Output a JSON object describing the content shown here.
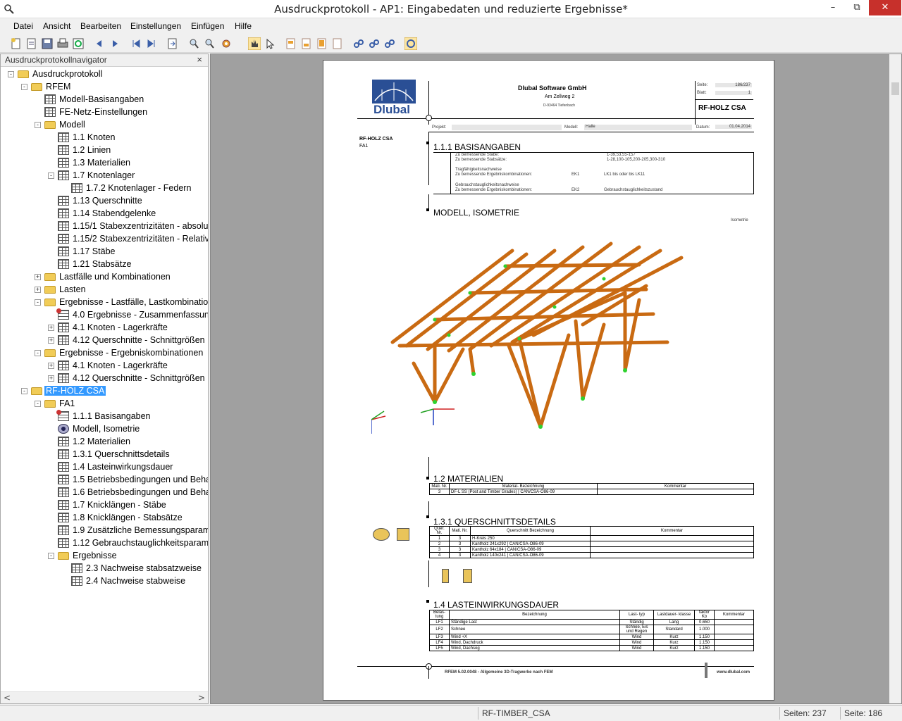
{
  "window": {
    "title": "Ausdruckprotokoll - AP1: Eingabedaten und reduzierte Ergebnisse*",
    "minimize": "–",
    "maximize": "⧉",
    "close": "✕"
  },
  "menu": [
    "Datei",
    "Ansicht",
    "Bearbeiten",
    "Einstellungen",
    "Einfügen",
    "Hilfe"
  ],
  "navigator": {
    "title": "Ausdruckprotokollnavigator",
    "close": "×",
    "scroll_left": "<",
    "scroll_right": ">",
    "items": [
      {
        "label": "Ausdruckprotokoll",
        "icon": "folder-icon",
        "level": 0,
        "exp": "-"
      },
      {
        "label": "RFEM",
        "icon": "folder-icon",
        "level": 1,
        "exp": "-"
      },
      {
        "label": "Modell-Basisangaben",
        "icon": "table-icon",
        "level": 2,
        "exp": ""
      },
      {
        "label": "FE-Netz-Einstellungen",
        "icon": "table-icon",
        "level": 2,
        "exp": ""
      },
      {
        "label": "Modell",
        "icon": "folder-icon",
        "level": 2,
        "exp": "-"
      },
      {
        "label": "1.1 Knoten",
        "icon": "table-icon",
        "level": 3,
        "exp": ""
      },
      {
        "label": "1.2 Linien",
        "icon": "table-icon",
        "level": 3,
        "exp": ""
      },
      {
        "label": "1.3 Materialien",
        "icon": "table-icon",
        "level": 3,
        "exp": ""
      },
      {
        "label": "1.7 Knotenlager",
        "icon": "table-icon",
        "level": 3,
        "exp": "-"
      },
      {
        "label": "1.7.2 Knotenlager - Federn",
        "icon": "table-icon",
        "level": 4,
        "exp": ""
      },
      {
        "label": "1.13 Querschnitte",
        "icon": "table-icon",
        "level": 3,
        "exp": ""
      },
      {
        "label": "1.14 Stabendgelenke",
        "icon": "table-icon",
        "level": 3,
        "exp": ""
      },
      {
        "label": "1.15/1 Stabexzentrizitäten - absolut",
        "icon": "table-icon",
        "level": 3,
        "exp": ""
      },
      {
        "label": "1.15/2 Stabexzentrizitäten - Relativ",
        "icon": "table-icon",
        "level": 3,
        "exp": ""
      },
      {
        "label": "1.17 Stäbe",
        "icon": "table-icon",
        "level": 3,
        "exp": ""
      },
      {
        "label": "1.21 Stabsätze",
        "icon": "table-icon",
        "level": 3,
        "exp": ""
      },
      {
        "label": "Lastfälle und Kombinationen",
        "icon": "folder-icon",
        "level": 2,
        "exp": "+"
      },
      {
        "label": "Lasten",
        "icon": "folder-icon",
        "level": 2,
        "exp": "+"
      },
      {
        "label": "Ergebnisse - Lastfälle, Lastkombinationen",
        "icon": "folder-icon",
        "level": 2,
        "exp": "-"
      },
      {
        "label": "4.0 Ergebnisse - Zusammenfassung",
        "icon": "result-icon",
        "level": 3,
        "exp": ""
      },
      {
        "label": "4.1 Knoten - Lagerkräfte",
        "icon": "table-icon",
        "level": 3,
        "exp": "+"
      },
      {
        "label": "4.12 Querschnitte - Schnittgrößen",
        "icon": "table-icon",
        "level": 3,
        "exp": "+"
      },
      {
        "label": "Ergebnisse - Ergebniskombinationen",
        "icon": "folder-icon",
        "level": 2,
        "exp": "-"
      },
      {
        "label": "4.1 Knoten - Lagerkräfte",
        "icon": "table-icon",
        "level": 3,
        "exp": "+"
      },
      {
        "label": "4.12 Querschnitte - Schnittgrößen",
        "icon": "table-icon",
        "level": 3,
        "exp": "+"
      },
      {
        "label": "RF-HOLZ CSA",
        "icon": "folder-icon",
        "level": 1,
        "exp": "-",
        "selected": true
      },
      {
        "label": "FA1",
        "icon": "folder-icon",
        "level": 2,
        "exp": "-"
      },
      {
        "label": "1.1.1 Basisangaben",
        "icon": "result-icon",
        "level": 3,
        "exp": ""
      },
      {
        "label": "Modell, Isometrie",
        "icon": "eye-icon",
        "level": 3,
        "exp": ""
      },
      {
        "label": "1.2 Materialien",
        "icon": "table-icon",
        "level": 3,
        "exp": ""
      },
      {
        "label": "1.3.1 Querschnittsdetails",
        "icon": "table-icon",
        "level": 3,
        "exp": ""
      },
      {
        "label": "1.4 Lasteinwirkungsdauer",
        "icon": "table-icon",
        "level": 3,
        "exp": ""
      },
      {
        "label": "1.5 Betriebsbedingungen und Behar",
        "icon": "table-icon",
        "level": 3,
        "exp": ""
      },
      {
        "label": "1.6 Betriebsbedingungen und Behar",
        "icon": "table-icon",
        "level": 3,
        "exp": ""
      },
      {
        "label": "1.7 Knicklängen - Stäbe",
        "icon": "table-icon",
        "level": 3,
        "exp": ""
      },
      {
        "label": "1.8 Knicklängen - Stabsätze",
        "icon": "table-icon",
        "level": 3,
        "exp": ""
      },
      {
        "label": "1.9 Zusätzliche Bemessungsparamet",
        "icon": "table-icon",
        "level": 3,
        "exp": ""
      },
      {
        "label": "1.12  Gebrauchstauglichkeitsparame",
        "icon": "table-icon",
        "level": 3,
        "exp": ""
      },
      {
        "label": "Ergebnisse",
        "icon": "folder-icon",
        "level": 3,
        "exp": "-"
      },
      {
        "label": "2.3 Nachweise stabsatzweise",
        "icon": "table-icon",
        "level": 4,
        "exp": ""
      },
      {
        "label": "2.4 Nachweise stabweise",
        "icon": "table-icon",
        "level": 4,
        "exp": ""
      }
    ]
  },
  "page": {
    "company": "Dlubal Software GmbH",
    "street": "Am Zellweg 2",
    "city": "D-93464 Tiefenbach",
    "logo_text": "Dlubal",
    "seite_label": "Seite:",
    "seite_value": "186/237",
    "blatt_label": "Blatt:",
    "blatt_value": "1",
    "module": "RF-HOLZ CSA",
    "projekt_label": "Projekt:",
    "modell_label": "Modell:",
    "modell_value": "Halle",
    "datum_label": "Datum:",
    "datum_value": "01.04.2014",
    "side_module": "RF-HOLZ CSA",
    "side_case": "FA1",
    "sec1": "1.1.1 BASISANGABEN",
    "basis": [
      [
        "Zu bemessende Stäbe:",
        "1-39,53,55-157"
      ],
      [
        "Zu bemessende Stabsätze:",
        "1-28,100-105,200-205,300-310"
      ]
    ],
    "basis_h1": "Tragfähigkeitsnachweise",
    "basis_r1a": "Zu bemessende Ergebniskombinationen:",
    "basis_r1b": "EK1",
    "basis_r1c": "LK1 bis oder bis LK11",
    "basis_h2": "Gebrauchstauglichkeitsnachweise",
    "basis_r2a": "Zu bemessende Ergebniskombinationen:",
    "basis_r2b": "EK2",
    "basis_r2c": "Gebrauchstauglichkeitszustand",
    "sec2": "MODELL, ISOMETRIE",
    "iso_label": "Isometrie",
    "sec3": "1.2 MATERIALIEN",
    "mat_head": [
      "Mati.\nNr.",
      "Material-\nBezeichnung",
      "Kommentar"
    ],
    "mat_row": [
      "3",
      "DF-L SS (Post and Timber Grades) | CAN/CSA-O86-09",
      ""
    ],
    "sec4": "1.3.1 QUERSCHNITTSDETAILS",
    "qs_head": [
      "Quer.\nNr.",
      "Mati.\nNr.",
      "Querschnitt\nBezeichnung",
      "Kommentar"
    ],
    "qs_rows": [
      [
        "1",
        "3",
        "H-Kreis 250",
        ""
      ],
      [
        "2",
        "3",
        "Kantholz 241x292 | CAN/CSA-O86-09",
        ""
      ],
      [
        "3",
        "3",
        "Kantholz 64x184 | CAN/CSA-O86-09",
        ""
      ],
      [
        "4",
        "3",
        "Kantholz 140x241 | CAN/CSA-O86-09",
        ""
      ]
    ],
    "sec5": "1.4 LASTEINWIRKUNGSDAUER",
    "ld_head": [
      "Belas-\ntung",
      "Bezeichnung",
      "Last-\ntyp",
      "Lastdauer-\nklasse",
      "faktor\nKᴅ",
      "Kommentar"
    ],
    "ld_rows": [
      [
        "LF1",
        "Ständige Last",
        "Ständig",
        "Lang",
        "0.650",
        ""
      ],
      [
        "LF2",
        "Schnee",
        "Schnee, Eis und Regen",
        "Standard",
        "1.000",
        ""
      ],
      [
        "LF3",
        "Wind +X",
        "Wind",
        "Kurz",
        "1.150",
        ""
      ],
      [
        "LF4",
        "Wind, Dachdruck",
        "Wind",
        "Kurz",
        "1.150",
        ""
      ],
      [
        "LF5",
        "Wind, Dachsog",
        "Wind",
        "Kurz",
        "1.150",
        ""
      ]
    ],
    "footer_left": "RFEM 5.02.0048 - Allgemeine 3D-Tragwerke nach FEM",
    "footer_right": "www.dlubal.com"
  },
  "status": {
    "module": "RF-TIMBER_CSA",
    "pages": "Seiten: 237",
    "page": "Seite: 186"
  }
}
